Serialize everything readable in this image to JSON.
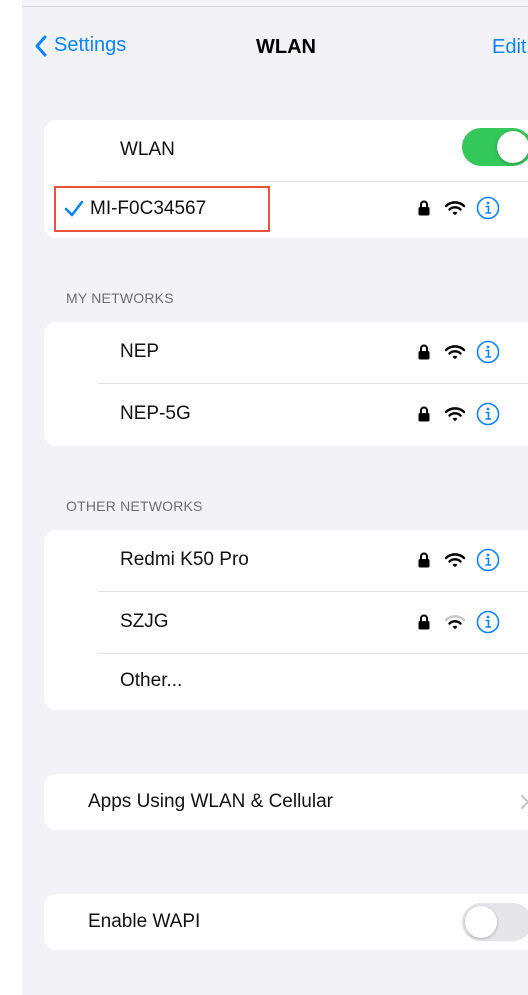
{
  "nav": {
    "back_label": "Settings",
    "title": "WLAN",
    "edit_label": "Edit"
  },
  "wlan_toggle": {
    "label": "WLAN",
    "state": "on"
  },
  "connected_network": {
    "name": "MI-F0C34567",
    "secured": true,
    "signal": "full"
  },
  "my_networks": {
    "header": "MY NETWORKS",
    "items": [
      {
        "name": "NEP",
        "secured": true,
        "signal": "full"
      },
      {
        "name": "NEP-5G",
        "secured": true,
        "signal": "full"
      }
    ]
  },
  "other_networks": {
    "header": "OTHER NETWORKS",
    "items": [
      {
        "name": "Redmi K50 Pro",
        "secured": true,
        "signal": "full"
      },
      {
        "name": "SZJG",
        "secured": true,
        "signal": "weak"
      }
    ],
    "other_label": "Other..."
  },
  "apps_using": {
    "label": "Apps Using WLAN & Cellular"
  },
  "wapi": {
    "label": "Enable WAPI",
    "state": "off"
  },
  "colors": {
    "accent": "#0a84ff",
    "toggle_on": "#34c759",
    "highlight": "#e8543b"
  },
  "icons": [
    "chevron-left-icon",
    "checkmark-icon",
    "lock-icon",
    "wifi-icon",
    "info-icon",
    "chevron-right-icon"
  ]
}
